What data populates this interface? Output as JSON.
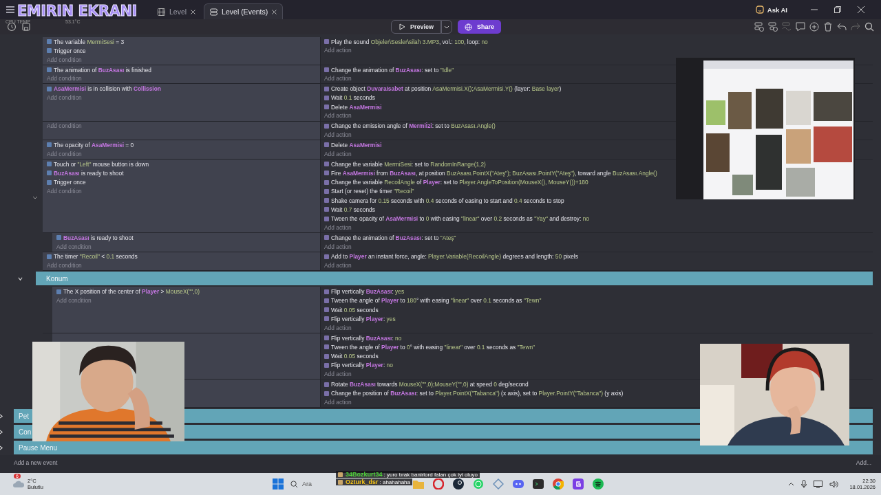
{
  "overlay": {
    "stream_title": "EMIRIN EKRANI",
    "cpu_label": "CPU TEMP",
    "cpu_value": "53.1°C"
  },
  "tabs": [
    {
      "label": "Level",
      "selected": false
    },
    {
      "label": "Level (Events)",
      "selected": true
    }
  ],
  "ask_ai": "Ask AI",
  "toolbar": {
    "preview": "Preview",
    "share": "Share"
  },
  "events": [
    {
      "kind": "event",
      "conditions": [
        "The variable *MermiSesi* = 3",
        "Trigger once"
      ],
      "add_condition": "Add condition",
      "actions": [
        "Play the sound *Objeler\\Sesler\\silah 3.MP3*, vol.: *100*, loop: *no*"
      ],
      "add_action": "Add action"
    },
    {
      "kind": "event",
      "conditions": [
        "The animation of **BuzAsası** is finished"
      ],
      "add_condition": "Add condition",
      "actions": [
        "Change the animation of **BuzAsası**: set to *\"Idle\"*"
      ],
      "add_action": "Add action"
    },
    {
      "kind": "event",
      "conditions": [
        "**AsaMermisi** is in collision with **Collission**"
      ],
      "add_condition": "Add condition",
      "actions": [
        "Create object **DuvaraIsabet** at position *AsaMermisi.X();AsaMermisi.Y()* (layer: *Base layer*)",
        "Wait *0.1* seconds",
        "Delete **AsaMermisi**"
      ],
      "add_action": "Add action"
    },
    {
      "kind": "event",
      "add_condition": "Add condition",
      "actions": [
        "Change the emission angle of **Mermiİzi**: set to *BuzAsası.Angle()*"
      ],
      "add_action": "Add action"
    },
    {
      "kind": "event",
      "conditions": [
        "The opacity of **AsaMermisi** = 0"
      ],
      "add_condition": "Add condition",
      "actions": [
        "Delete **AsaMermisi**"
      ],
      "add_action": "Add action"
    },
    {
      "kind": "event",
      "conditions": [
        "Touch or *\"Left\"* mouse button is down",
        "**BuzAsası** is ready to shoot",
        "Trigger once"
      ],
      "add_condition": "Add condition",
      "actions": [
        "Change the variable *MermiSesi*: set to *RandomInRange(1,2)*",
        "Fire **AsaMermisi** from **BuzAsası**, at position *BuzAsası.PointX(\"Ateş\"); BuzAsası.PointY(\"Ateş\")*, toward angle *BuzAsası.Angle()*",
        "Change the variable *RecoilAngle* of **Player**: set to *Player.AngleToPosition(MouseX(), MouseY())+180*",
        "Start (or reset) the timer *\"Recoil\"*",
        "Shake camera for *0.15* seconds with *0.4* seconds of easing to start and *0.4* seconds to stop",
        "Wait *0.7* seconds",
        "Tween the opacity of **AsaMermisi** to *0* with easing *\"linear\"* over *0.2* seconds as *\"Yay\"* and destroy: *no*"
      ],
      "add_action": "Add action",
      "children": [
        {
          "kind": "event",
          "conditions": [
            "**BuzAsası** is ready to shoot"
          ],
          "add_condition": "Add condition",
          "actions": [
            "Change the animation of **BuzAsası**: set to *\"Ateş\"*"
          ],
          "add_action": "Add action"
        }
      ]
    },
    {
      "kind": "event",
      "conditions": [
        "The timer *\"Recoil\"* < *0.1* seconds"
      ],
      "add_condition": "Add condition",
      "actions": [
        "Add to **Player** an instant force, angle: *Player.Variable(RecoilAngle)* degrees and length: *50* pixels"
      ],
      "add_action": "Add action"
    },
    {
      "kind": "group",
      "title": "Konum",
      "expanded": true,
      "children": [
        {
          "kind": "event",
          "conditions": [
            "The X position of the center of **Player** > *MouseX(\"\",0)*"
          ],
          "add_condition": "Add condition",
          "actions": [
            "Flip vertically **BuzAsası**: *yes*",
            "Tween the angle of **Player** to *180*° with easing *\"linear\"* over *0.1* seconds as *\"Tewn\"*",
            "Wait *0.05* seconds",
            "Flip vertically **Player**: *yes*"
          ],
          "add_action": "Add action"
        },
        {
          "kind": "event",
          "actions": [
            "Flip vertically **BuzAsası**: *no*",
            "Tween the angle of **Player** to *0*° with easing *\"linear\"* over *0.1* seconds as *\"Tewn\"*",
            "Wait *0.05* seconds",
            "Flip vertically **Player**: *no*"
          ],
          "add_action": "Add action"
        },
        {
          "kind": "event",
          "actions": [
            "Rotate **BuzAsası** towards *MouseX(\"\",0);MouseY(\"\",0)* at speed *0* deg/second",
            "Change the position of **BuzAsası**: set to *Player.PointX(\"Tabanca\")* (x axis), set to *Player.PointY(\"Tabanca\")* (y axis)"
          ],
          "add_action": "Add action"
        }
      ]
    },
    {
      "kind": "group",
      "title": "Pet",
      "expanded": false
    },
    {
      "kind": "group",
      "title": "Con",
      "expanded": false
    },
    {
      "kind": "group",
      "title": "Pause Menu",
      "expanded": false
    }
  ],
  "add_new_event": "Add a new event",
  "add_more": "Add...",
  "taskbar": {
    "weather_badge": "6",
    "temperature": "2°C",
    "weather": "Bulutlu",
    "search": "Ara",
    "time": "22:30",
    "date": "18.01.2026"
  },
  "chat": [
    {
      "name": "34Bozkurt34",
      "color": "#4cd137",
      "text": ": yuro tırak banirlord falan çok iyi oluyo"
    },
    {
      "name": "Ozturk_dsr",
      "color": "#f5c518",
      "text": ": ahahahaha"
    }
  ]
}
